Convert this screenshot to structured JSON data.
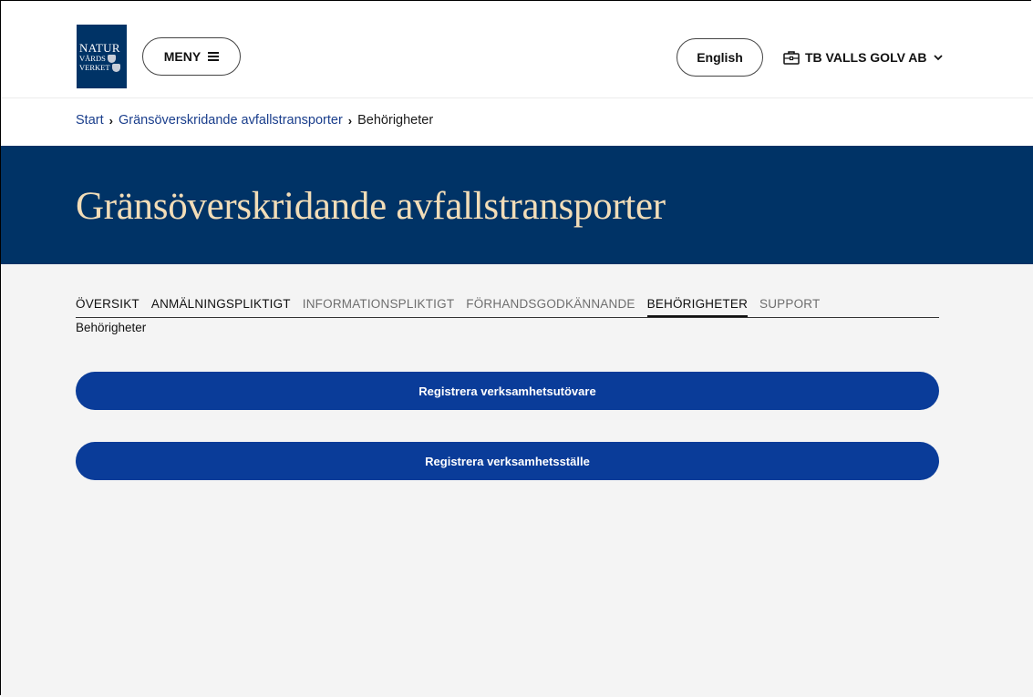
{
  "header": {
    "logo": {
      "line1": "NATUR",
      "line2": "VÅRDS",
      "line3": "VERKET"
    },
    "menu_label": "MENY",
    "language_label": "English",
    "org_name": "TB VALLS GOLV AB"
  },
  "breadcrumb": {
    "items": [
      "Start",
      "Gränsöverskridande avfallstransporter",
      "Behörigheter"
    ]
  },
  "banner": {
    "title": "Gränsöverskridande avfallstransporter"
  },
  "tabs": [
    {
      "label": "ÖVERSIKT"
    },
    {
      "label": "ANMÄLNINGSPLIKTIGT"
    },
    {
      "label": "INFORMATIONSPLIKTIGT"
    },
    {
      "label": "FÖRHANDSGODKÄNNANDE"
    },
    {
      "label": "BEHÖRIGHETER"
    },
    {
      "label": "SUPPORT"
    }
  ],
  "section_title": "Behörigheter",
  "actions": {
    "register_operator": "Registrera verksamhetsutövare",
    "register_site": "Registrera verksamhetsställe"
  },
  "colors": {
    "brand_navy": "#003366",
    "banner_title": "#f2ddb8",
    "primary_button": "#0a3c99",
    "link": "#1a3e8c",
    "page_bg": "#f4f4f4"
  }
}
